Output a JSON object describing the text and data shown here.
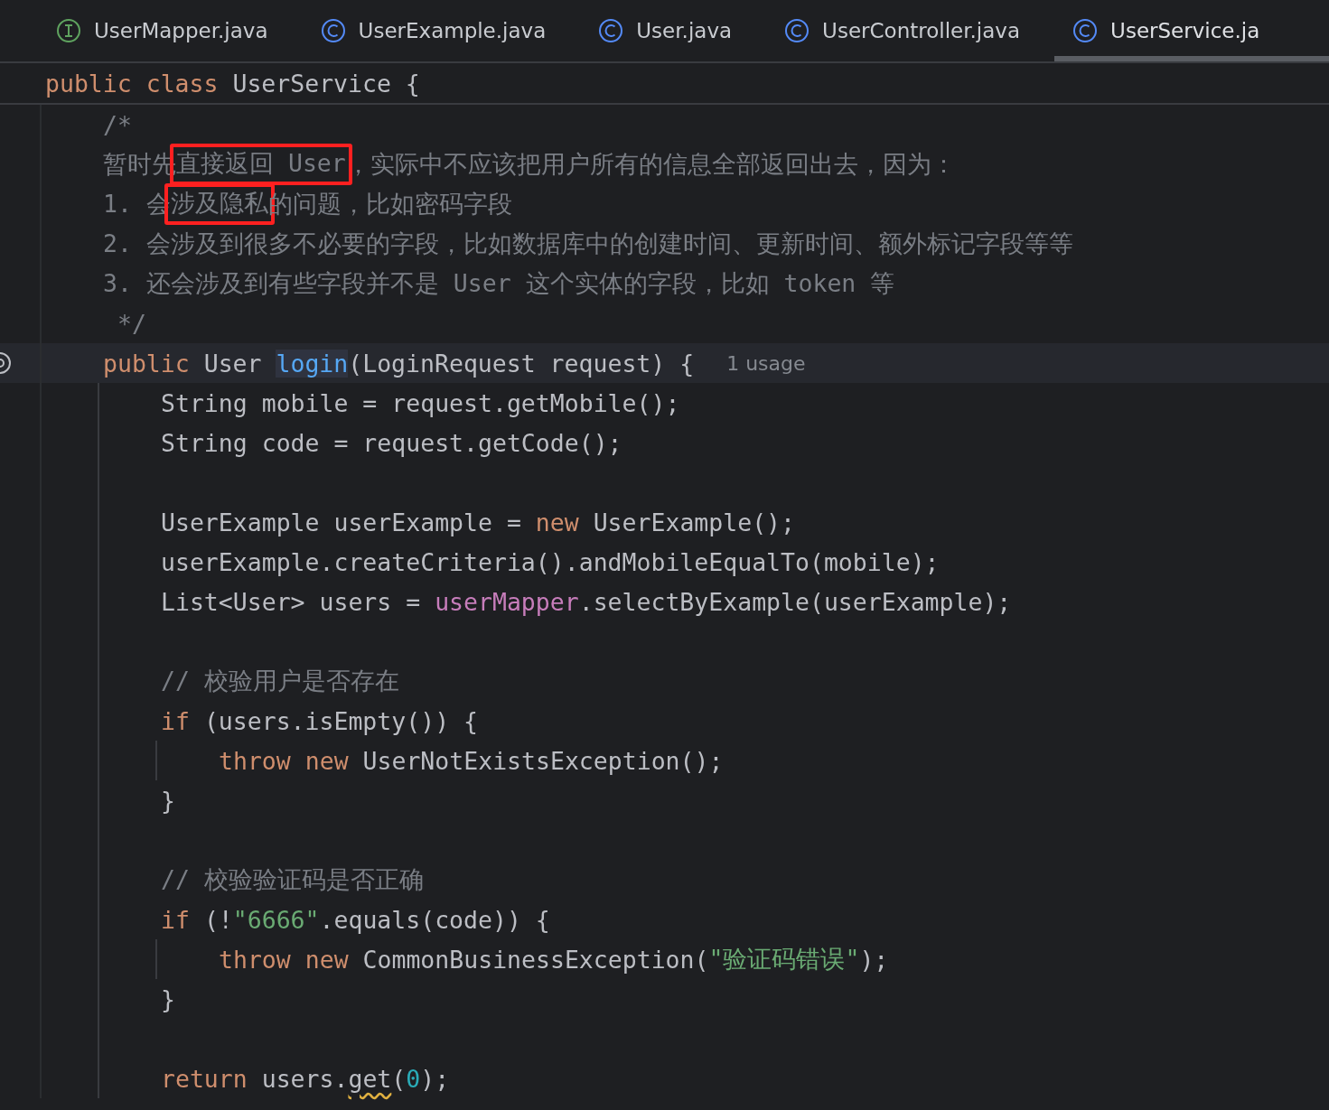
{
  "tabs": [
    {
      "label": "UserMapper.java",
      "kind": "interface",
      "selected": false
    },
    {
      "label": "UserExample.java",
      "kind": "class",
      "selected": false
    },
    {
      "label": "User.java",
      "kind": "class",
      "selected": false
    },
    {
      "label": "UserController.java",
      "kind": "class",
      "selected": false
    },
    {
      "label": "UserService.ja",
      "kind": "class",
      "selected": true
    }
  ],
  "sticky_header": {
    "tokens": [
      {
        "kind": "kw",
        "t": "public class "
      },
      {
        "kind": "plain",
        "t": "UserService {"
      }
    ]
  },
  "lines": [
    {
      "kind": "code",
      "current": false,
      "tokens": [
        {
          "kind": "comment",
          "t": "/*"
        }
      ]
    },
    {
      "kind": "code",
      "current": false,
      "tokens": [
        {
          "kind": "comment",
          "t": "暂时先",
          "boxed": false
        },
        {
          "kind": "comment",
          "t": "直接返回 User",
          "boxed": true
        },
        {
          "kind": "comment",
          "t": "，实际中不应该把用户所有的信息全部返回出去，因为：",
          "boxed": false
        }
      ]
    },
    {
      "kind": "code",
      "current": false,
      "tokens": [
        {
          "kind": "comment",
          "t": "1. 会",
          "boxed": false
        },
        {
          "kind": "comment",
          "t": "涉及隐私",
          "boxed": true
        },
        {
          "kind": "comment",
          "t": "的问题，比如密码字段",
          "boxed": false
        }
      ]
    },
    {
      "kind": "code",
      "current": false,
      "tokens": [
        {
          "kind": "comment",
          "t": "2. 会涉及到很多不必要的字段，比如数据库中的创建时间、更新时间、额外标记字段等等"
        }
      ]
    },
    {
      "kind": "code",
      "current": false,
      "tokens": [
        {
          "kind": "comment",
          "t": "3. 还会涉及到有些字段并不是 User 这个实体的字段，比如 token 等"
        }
      ]
    },
    {
      "kind": "code",
      "current": false,
      "tokens": [
        {
          "kind": "comment",
          "t": " */"
        }
      ]
    },
    {
      "kind": "code",
      "current": true,
      "gutter_icon": true,
      "tokens": [
        {
          "kind": "kw",
          "t": "public "
        },
        {
          "kind": "plain",
          "t": "User "
        },
        {
          "kind": "decl",
          "t": "login"
        },
        {
          "kind": "plain",
          "t": "(LoginRequest request) {"
        },
        {
          "kind": "hint",
          "t": "1 usage"
        }
      ],
      "children": [
        {
          "kind": "code",
          "current": false,
          "tokens": [
            {
              "kind": "plain",
              "t": "String mobile = request.getMobile();"
            }
          ]
        },
        {
          "kind": "code",
          "current": false,
          "tokens": [
            {
              "kind": "plain",
              "t": "String code = request.getCode();"
            }
          ]
        },
        {
          "kind": "blank",
          "current": false
        },
        {
          "kind": "code",
          "current": false,
          "tokens": [
            {
              "kind": "plain",
              "t": "UserExample userExample = "
            },
            {
              "kind": "kw",
              "t": "new "
            },
            {
              "kind": "plain",
              "t": "UserExample();"
            }
          ]
        },
        {
          "kind": "code",
          "current": false,
          "tokens": [
            {
              "kind": "plain",
              "t": "userExample.createCriteria().andMobileEqualTo(mobile);"
            }
          ]
        },
        {
          "kind": "code",
          "current": false,
          "tokens": [
            {
              "kind": "plain",
              "t": "List<User> users = "
            },
            {
              "kind": "field",
              "t": "userMapper"
            },
            {
              "kind": "plain",
              "t": ".selectByExample(userExample);"
            }
          ]
        },
        {
          "kind": "blank",
          "current": false
        },
        {
          "kind": "code",
          "current": false,
          "tokens": [
            {
              "kind": "comment",
              "t": "// 校验用户是否存在"
            }
          ]
        },
        {
          "kind": "code",
          "current": false,
          "tokens": [
            {
              "kind": "kw",
              "t": "if "
            },
            {
              "kind": "plain",
              "t": "(users.isEmpty()) {"
            }
          ],
          "children": [
            {
              "kind": "code",
              "current": false,
              "tokens": [
                {
                  "kind": "kw",
                  "t": "throw new "
                },
                {
                  "kind": "plain",
                  "t": "UserNotExistsException();"
                }
              ]
            }
          ]
        },
        {
          "kind": "code",
          "current": false,
          "tokens": [
            {
              "kind": "plain",
              "t": "}"
            }
          ]
        },
        {
          "kind": "blank",
          "current": false
        },
        {
          "kind": "code",
          "current": false,
          "tokens": [
            {
              "kind": "comment",
              "t": "// 校验验证码是否正确"
            }
          ]
        },
        {
          "kind": "code",
          "current": false,
          "tokens": [
            {
              "kind": "kw",
              "t": "if "
            },
            {
              "kind": "plain",
              "t": "(!"
            },
            {
              "kind": "string",
              "t": "\"6666\""
            },
            {
              "kind": "plain",
              "t": ".equals(code)) {"
            }
          ],
          "children": [
            {
              "kind": "code",
              "current": false,
              "tokens": [
                {
                  "kind": "kw",
                  "t": "throw new "
                },
                {
                  "kind": "plain",
                  "t": "CommonBusinessException("
                },
                {
                  "kind": "string",
                  "t": "\"验证码错误\""
                },
                {
                  "kind": "plain",
                  "t": ");"
                }
              ]
            }
          ]
        },
        {
          "kind": "code",
          "current": false,
          "tokens": [
            {
              "kind": "plain",
              "t": "}"
            }
          ]
        },
        {
          "kind": "blank",
          "current": false
        },
        {
          "kind": "code",
          "current": false,
          "tokens": [
            {
              "kind": "kw",
              "t": "return "
            },
            {
              "kind": "plain",
              "t": "users."
            },
            {
              "kind": "warn",
              "t": "get"
            },
            {
              "kind": "plain",
              "t": "("
            },
            {
              "kind": "number",
              "t": "0"
            },
            {
              "kind": "plain",
              "t": ");"
            }
          ]
        }
      ]
    }
  ]
}
